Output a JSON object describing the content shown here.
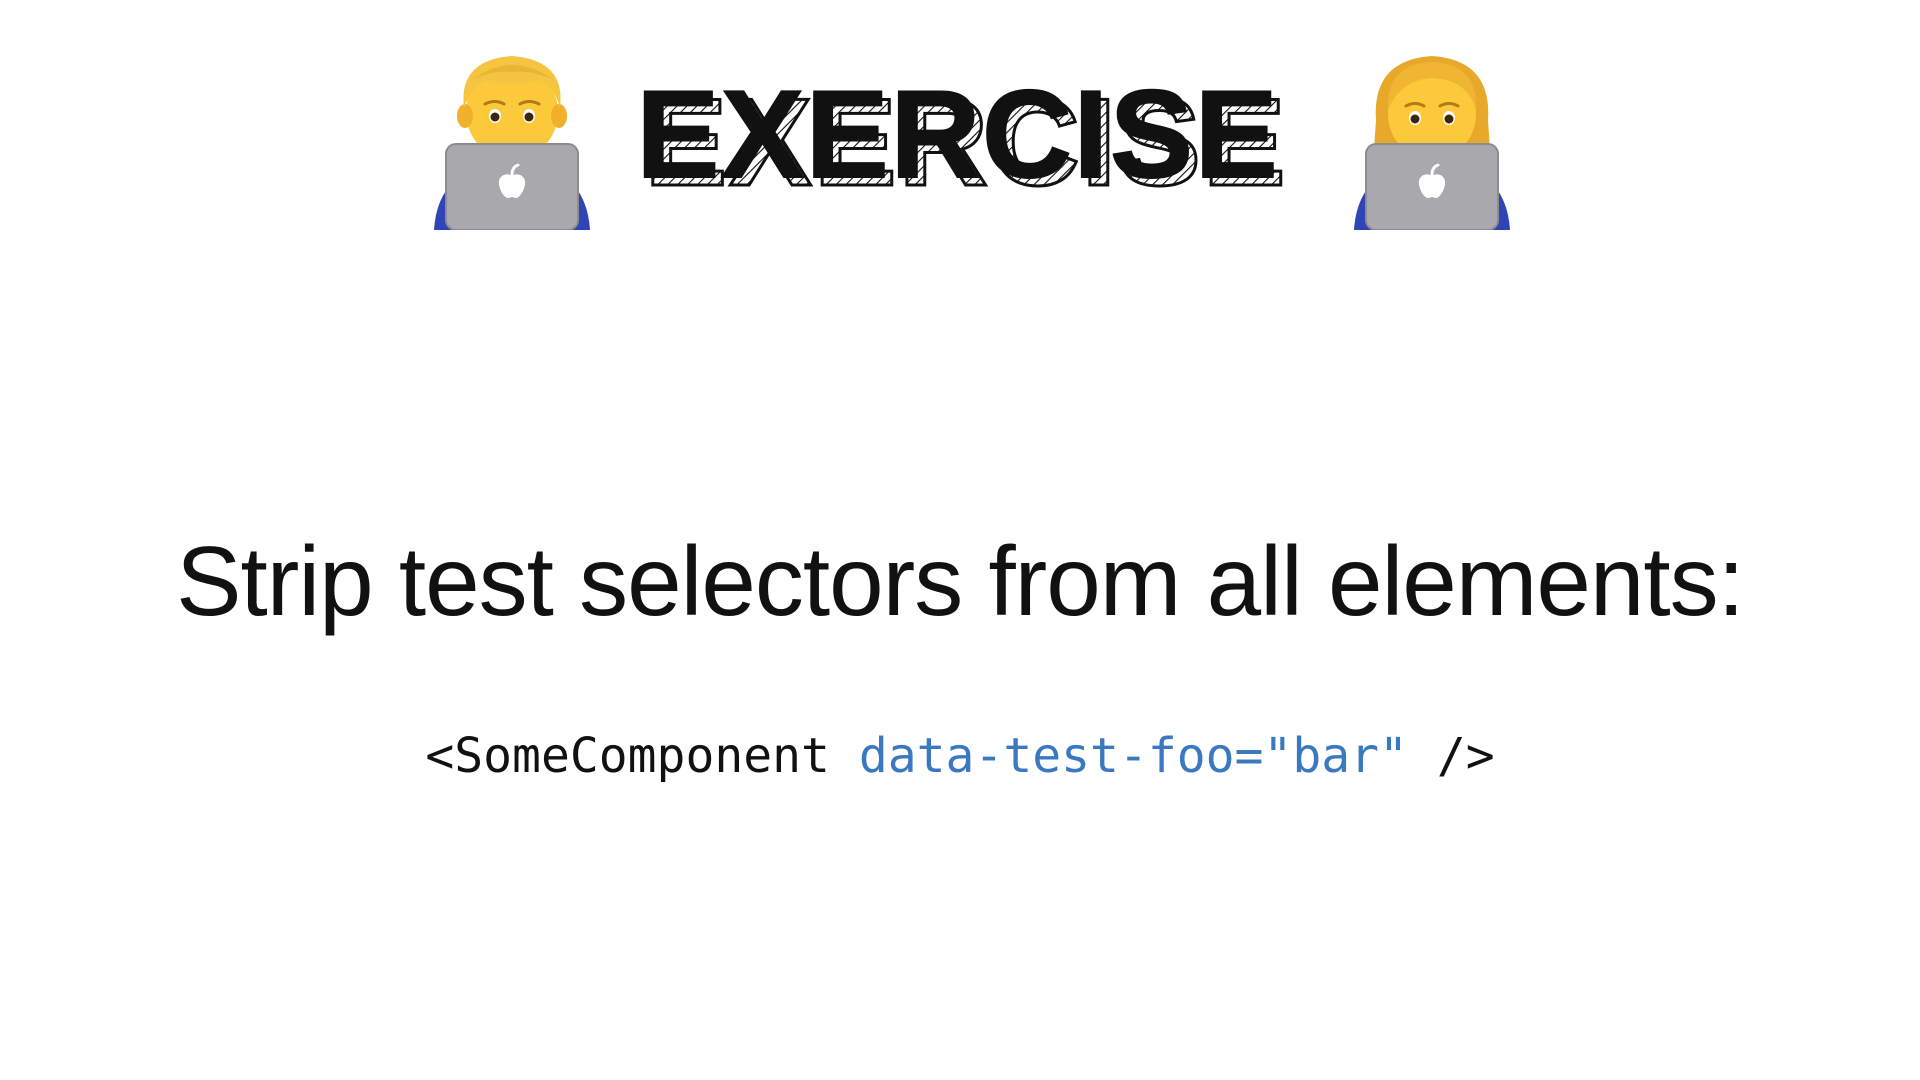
{
  "slide": {
    "title": "EXERCISE",
    "icons": {
      "left": "man-technologist-icon",
      "right": "woman-technologist-icon"
    },
    "headline": "Strip test selectors from all elements:",
    "code": {
      "tag_open": "<SomeComponent",
      "attribute": "data-test-foo=\"bar\"",
      "tag_close": "/>"
    }
  },
  "colors": {
    "background": "#ffffff",
    "text": "#111111",
    "code_attribute": "#3a78c0"
  }
}
